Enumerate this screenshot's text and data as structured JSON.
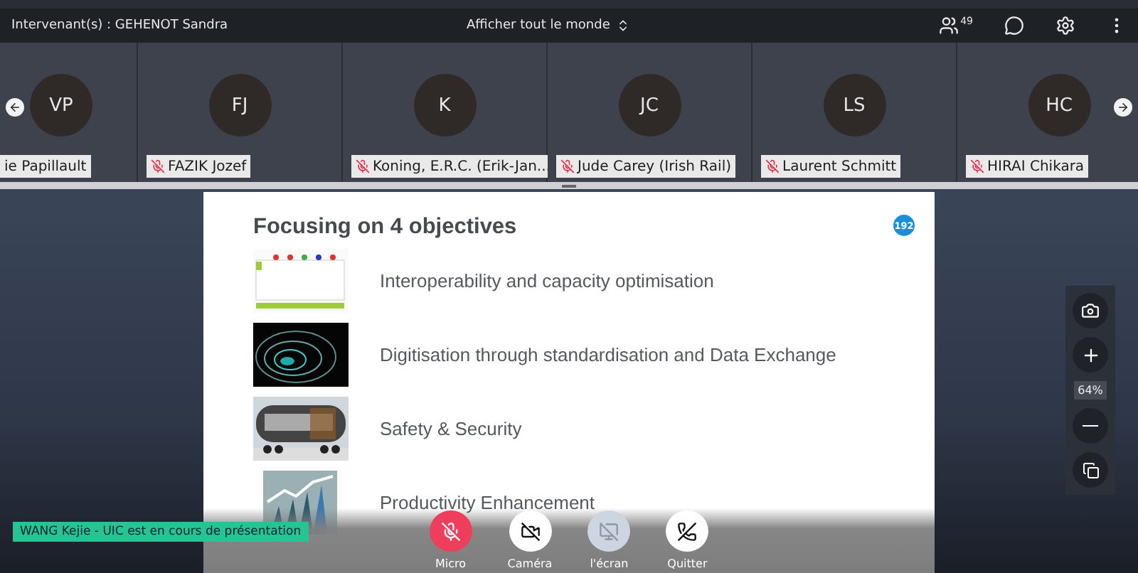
{
  "top_bar": {
    "speakers": "Intervenant(s) : GEHENOT Sandra",
    "view_selector": "Afficher tout le monde",
    "participant_count": "49"
  },
  "participants": [
    {
      "initials": "VP",
      "name": "ie Papillault",
      "muted": false
    },
    {
      "initials": "FJ",
      "name": "FAZIK Jozef",
      "muted": true
    },
    {
      "initials": "K",
      "name": "Koning, E.R.C. (Erik-Jan...",
      "muted": true
    },
    {
      "initials": "JC",
      "name": "Jude Carey (Irish Rail)",
      "muted": true
    },
    {
      "initials": "LS",
      "name": "Laurent Schmitt",
      "muted": true
    },
    {
      "initials": "HC",
      "name": "HIRAI Chikara",
      "muted": true
    }
  ],
  "slide": {
    "title": "Focusing on 4 objectives",
    "page_badge": "192",
    "items": [
      {
        "text": "Interoperability and capacity optimisation",
        "kind": "picture"
      },
      {
        "text": "Digitisation through standardisation and Data Exchange",
        "kind": "picture"
      },
      {
        "text": "Safety & Security",
        "kind": "picture"
      },
      {
        "text": "Productivity Enhancement",
        "kind": "picture"
      }
    ]
  },
  "zoom_panel": {
    "zoom": "64%"
  },
  "presenter_banner": "WANG Kejie - UIC est en cours de présentation",
  "controls": [
    {
      "kind": "mic",
      "label": "Micro",
      "highlighted": true,
      "disabled": false
    },
    {
      "kind": "camera",
      "label": "Caméra",
      "highlighted": false,
      "disabled": false
    },
    {
      "kind": "screen",
      "label": "l'écran",
      "highlighted": false,
      "disabled": true
    },
    {
      "kind": "leave",
      "label": "Quitter",
      "highlighted": false,
      "disabled": false
    }
  ]
}
